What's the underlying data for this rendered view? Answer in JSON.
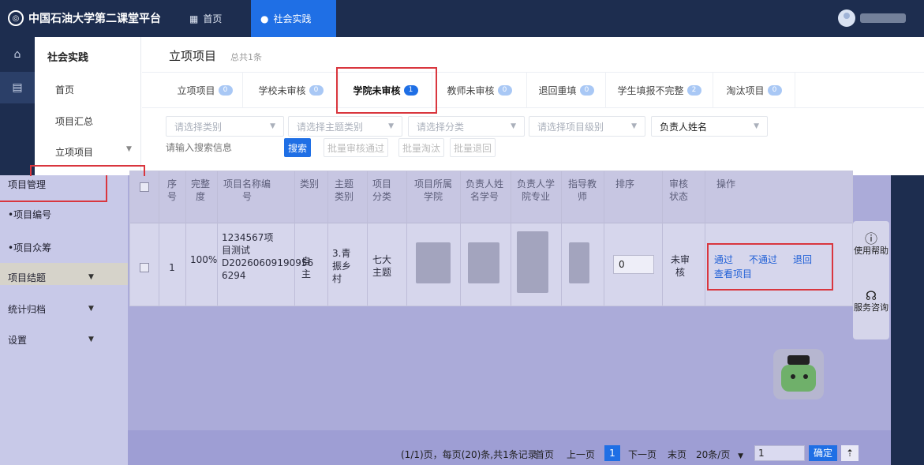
{
  "header": {
    "app_title": "中国石油大学第二课堂平台",
    "nav": [
      {
        "label": "首页"
      },
      {
        "label": "社会实践"
      }
    ]
  },
  "sidebar": {
    "title": "社会实践",
    "items": [
      "首页",
      "项目汇总",
      "立项项目",
      "项目管理"
    ],
    "items2": [
      "项目管理",
      "•项目编号",
      "•项目众筹",
      "项目结题",
      "统计归档",
      "设置"
    ]
  },
  "page": {
    "title": "立项项目",
    "count": "总共1条"
  },
  "tabs": [
    {
      "label": "立项项目",
      "badge": "0"
    },
    {
      "label": "学校未审核",
      "badge": "0"
    },
    {
      "label": "学院未审核",
      "badge": "1"
    },
    {
      "label": "教师未审核",
      "badge": "0"
    },
    {
      "label": "退回重填",
      "badge": "0"
    },
    {
      "label": "学生填报不完整",
      "badge": "2"
    },
    {
      "label": "淘汰项目",
      "badge": "0"
    }
  ],
  "filters": {
    "category": "请选择类别",
    "theme_category": "请选择主题类别",
    "classification": "请选择分类",
    "level": "请选择项目级别",
    "leader": "负责人姓名",
    "search_placeholder": "请输入搜索信息",
    "search_btn": "搜索",
    "batch_approve": "批量审核通过",
    "batch_eliminate": "批量淘汰",
    "batch_return": "批量退回"
  },
  "table": {
    "headers": {
      "seq": "序号",
      "completion": "完整度",
      "proj_name_no": "项目名称编号",
      "type": "类别",
      "theme": "主题类别",
      "classify": "项目分类",
      "college": "项目所属学院",
      "leader_name": "负责人姓名学号",
      "leader_major": "负责人学院专业",
      "advisor": "指导教师",
      "sort": "排序",
      "status": "审核状态",
      "ops": "操作"
    },
    "row": {
      "seq": "1",
      "completion": "100%",
      "proj_name_no": "1234567项目测试D20260609190956 6294",
      "type": "自主",
      "theme": "3.青振乡村",
      "classify": "七大主题",
      "sort": "0",
      "status": "未审核",
      "op_pass": "通过",
      "op_reject": "不通过",
      "op_return": "退回",
      "op_view": "查看项目"
    }
  },
  "help": {
    "usage": "使用帮助",
    "service": "服务咨询"
  },
  "pager": {
    "summary": "(1/1)页，每页(20)条,共1条记录",
    "first": "首页",
    "prev": "上一页",
    "current": "1",
    "next": "下一页",
    "last": "末页",
    "page_size": "20条/页",
    "jump_value": "1",
    "confirm": "确定"
  },
  "colors": {
    "primary": "#1f6fe5",
    "header_bg": "#1d2d4f",
    "highlight_red": "#d9363e"
  }
}
